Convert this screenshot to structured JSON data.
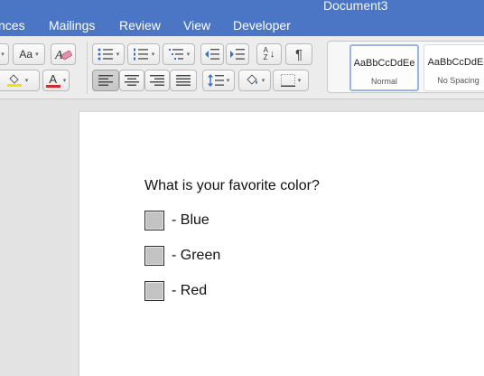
{
  "window": {
    "title": "Document3"
  },
  "tabs": [
    "nces",
    "Mailings",
    "Review",
    "View",
    "Developer"
  ],
  "ribbon": {
    "styles": [
      {
        "sample": "AaBbCcDdEe",
        "name": "Normal"
      },
      {
        "sample": "AaBbCcDdEe",
        "name": "No Spacing"
      }
    ],
    "icons": {
      "change_case": "Aa",
      "pilcrow": "¶",
      "sort_top": "A",
      "sort_bottom": "Z",
      "font_color_letter": "A"
    },
    "colors": {
      "highlight": "#f5e400",
      "font_color": "#d32a2a"
    }
  },
  "document": {
    "question": "What is your favorite color?",
    "options": [
      "- Blue",
      "- Green",
      "- Red"
    ]
  }
}
